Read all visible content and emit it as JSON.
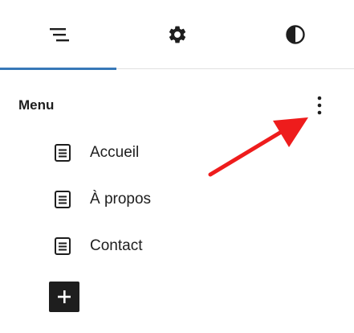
{
  "tabs": [
    {
      "icon": "list-view-icon",
      "active": true
    },
    {
      "icon": "gear-icon",
      "active": false
    },
    {
      "icon": "contrast-icon",
      "active": false
    }
  ],
  "menu": {
    "title": "Menu",
    "options_icon": "vertical-ellipsis-icon",
    "items": [
      {
        "label": "Accueil",
        "icon": "page-icon"
      },
      {
        "label": "À propos",
        "icon": "page-icon"
      },
      {
        "label": "Contact",
        "icon": "page-icon"
      }
    ],
    "add_icon": "plus-icon"
  },
  "colors": {
    "accent": "#3778b8",
    "annotation_arrow": "#ee1c1c",
    "text": "#1e1e1e",
    "divider": "#e0e0e0"
  }
}
